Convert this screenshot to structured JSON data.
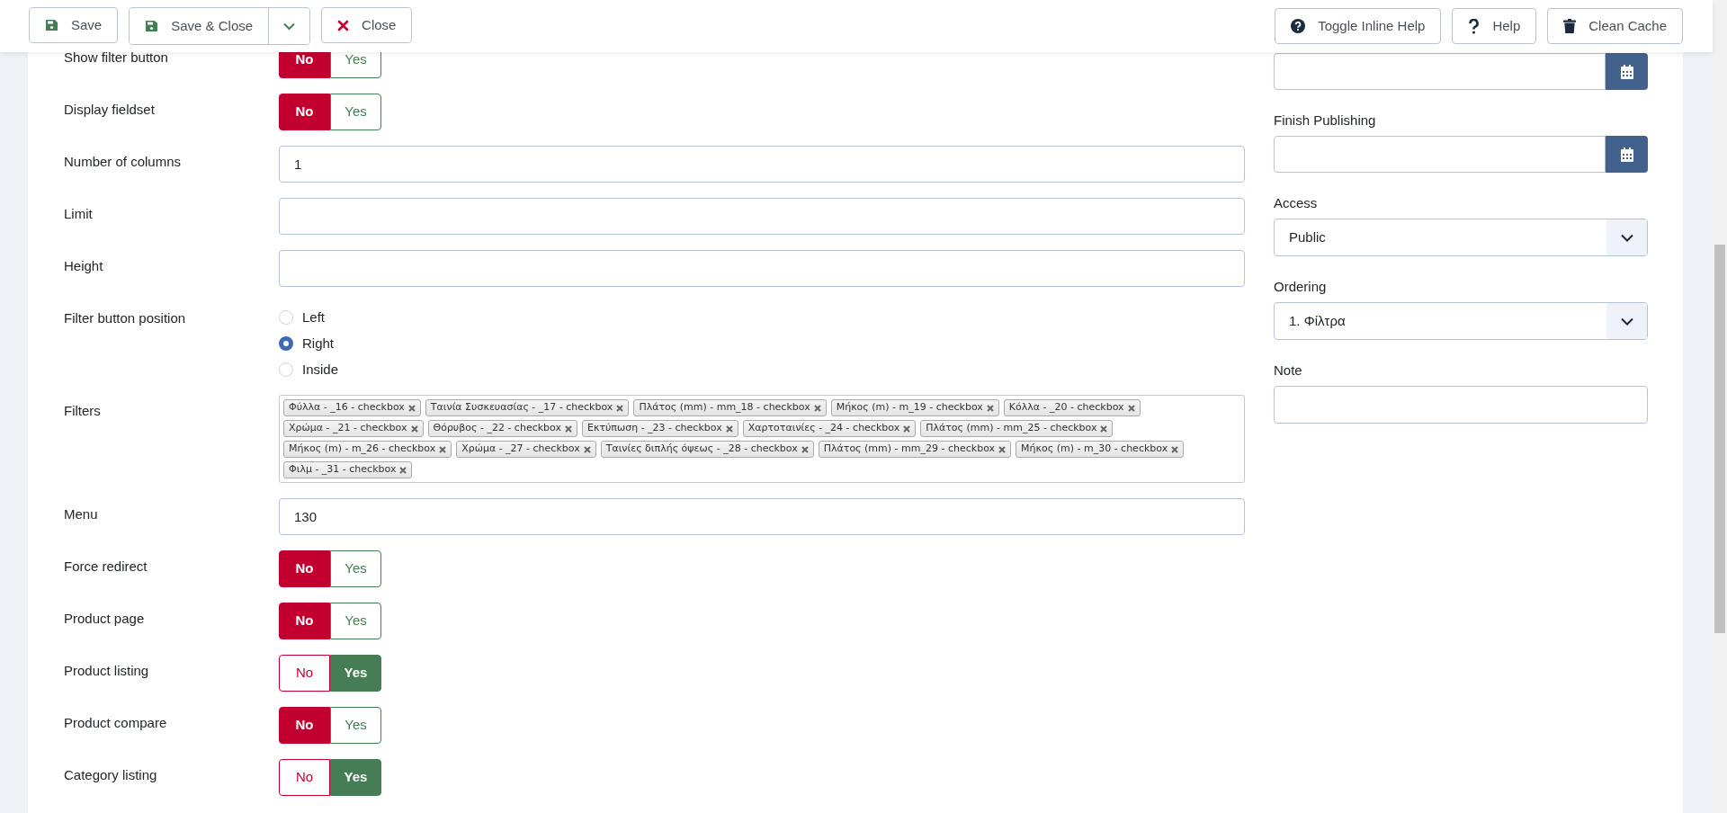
{
  "toolbar": {
    "left": [
      {
        "kind": "save",
        "label": "Save"
      },
      {
        "kind": "save",
        "label": "Save & Close",
        "dropdown": true
      },
      {
        "kind": "close",
        "label": "Close"
      }
    ],
    "right": [
      {
        "kind": "help-circle",
        "label": "Toggle Inline Help"
      },
      {
        "kind": "question",
        "label": "Help"
      },
      {
        "kind": "trash",
        "label": "Clean Cache"
      }
    ]
  },
  "fields": [
    {
      "kind": "toggle",
      "label": "Show filter button",
      "options": [
        {
          "label": "No",
          "selected": true
        },
        {
          "label": "Yes",
          "selected": false
        }
      ]
    },
    {
      "kind": "toggle",
      "label": "Display fieldset",
      "options": [
        {
          "label": "No",
          "selected": true
        },
        {
          "label": "Yes",
          "selected": false
        }
      ]
    },
    {
      "kind": "text",
      "label": "Number of columns",
      "value": "1"
    },
    {
      "kind": "text",
      "label": "Limit"
    },
    {
      "kind": "text",
      "label": "Height"
    },
    {
      "kind": "radio",
      "label": "Filter button position",
      "options": [
        {
          "label": "Left",
          "selected": false
        },
        {
          "label": "Right",
          "selected": true
        },
        {
          "label": "Inside",
          "selected": false
        }
      ]
    },
    {
      "kind": "tags",
      "label": "Filters",
      "tags": [
        "Φύλλα - _16 - checkbox",
        "Ταινία Συσκευασίας - _17 - checkbox",
        "Πλάτος (mm) - mm_18 - checkbox",
        "Μήκος (m) - m_19 - checkbox",
        "Κόλλα - _20 - checkbox",
        "Χρώμα - _21 - checkbox",
        "Θόρυβος - _22 - checkbox",
        "Εκτύπωση - _23 - checkbox",
        "Χαρτοταινίες - _24 - checkbox",
        "Πλάτος (mm) - mm_25 - checkbox",
        "Μήκος (m) - m_26 - checkbox",
        "Χρώμα - _27 - checkbox",
        "Ταινίες διπλής όψεως - _28 - checkbox",
        "Πλάτος (mm) - mm_29 - checkbox",
        "Μήκος (m) - m_30 - checkbox",
        "Φιλμ - _31 - checkbox"
      ]
    },
    {
      "kind": "text",
      "label": "Menu",
      "value": "130"
    },
    {
      "kind": "toggle",
      "label": "Force redirect",
      "options": [
        {
          "label": "No",
          "selected": true
        },
        {
          "label": "Yes",
          "selected": false
        }
      ]
    },
    {
      "kind": "toggle",
      "label": "Product page",
      "options": [
        {
          "label": "No",
          "selected": true
        },
        {
          "label": "Yes",
          "selected": false
        }
      ]
    },
    {
      "kind": "toggle",
      "label": "Product listing",
      "options": [
        {
          "label": "No",
          "selected": false
        },
        {
          "label": "Yes",
          "selected": true
        }
      ]
    },
    {
      "kind": "toggle",
      "label": "Product compare",
      "options": [
        {
          "label": "No",
          "selected": true
        },
        {
          "label": "Yes",
          "selected": false
        }
      ]
    },
    {
      "kind": "toggle",
      "label": "Category listing",
      "options": [
        {
          "label": "No",
          "selected": false
        },
        {
          "label": "Yes",
          "selected": true
        }
      ]
    }
  ],
  "sidebar": [
    {
      "kind": "calendar"
    },
    {
      "kind": "calendar",
      "label": "Finish Publishing"
    },
    {
      "kind": "select",
      "label": "Access",
      "value": "Public"
    },
    {
      "kind": "select",
      "label": "Ordering",
      "value": "1. Φίλτρα"
    },
    {
      "kind": "text",
      "label": "Note"
    }
  ]
}
